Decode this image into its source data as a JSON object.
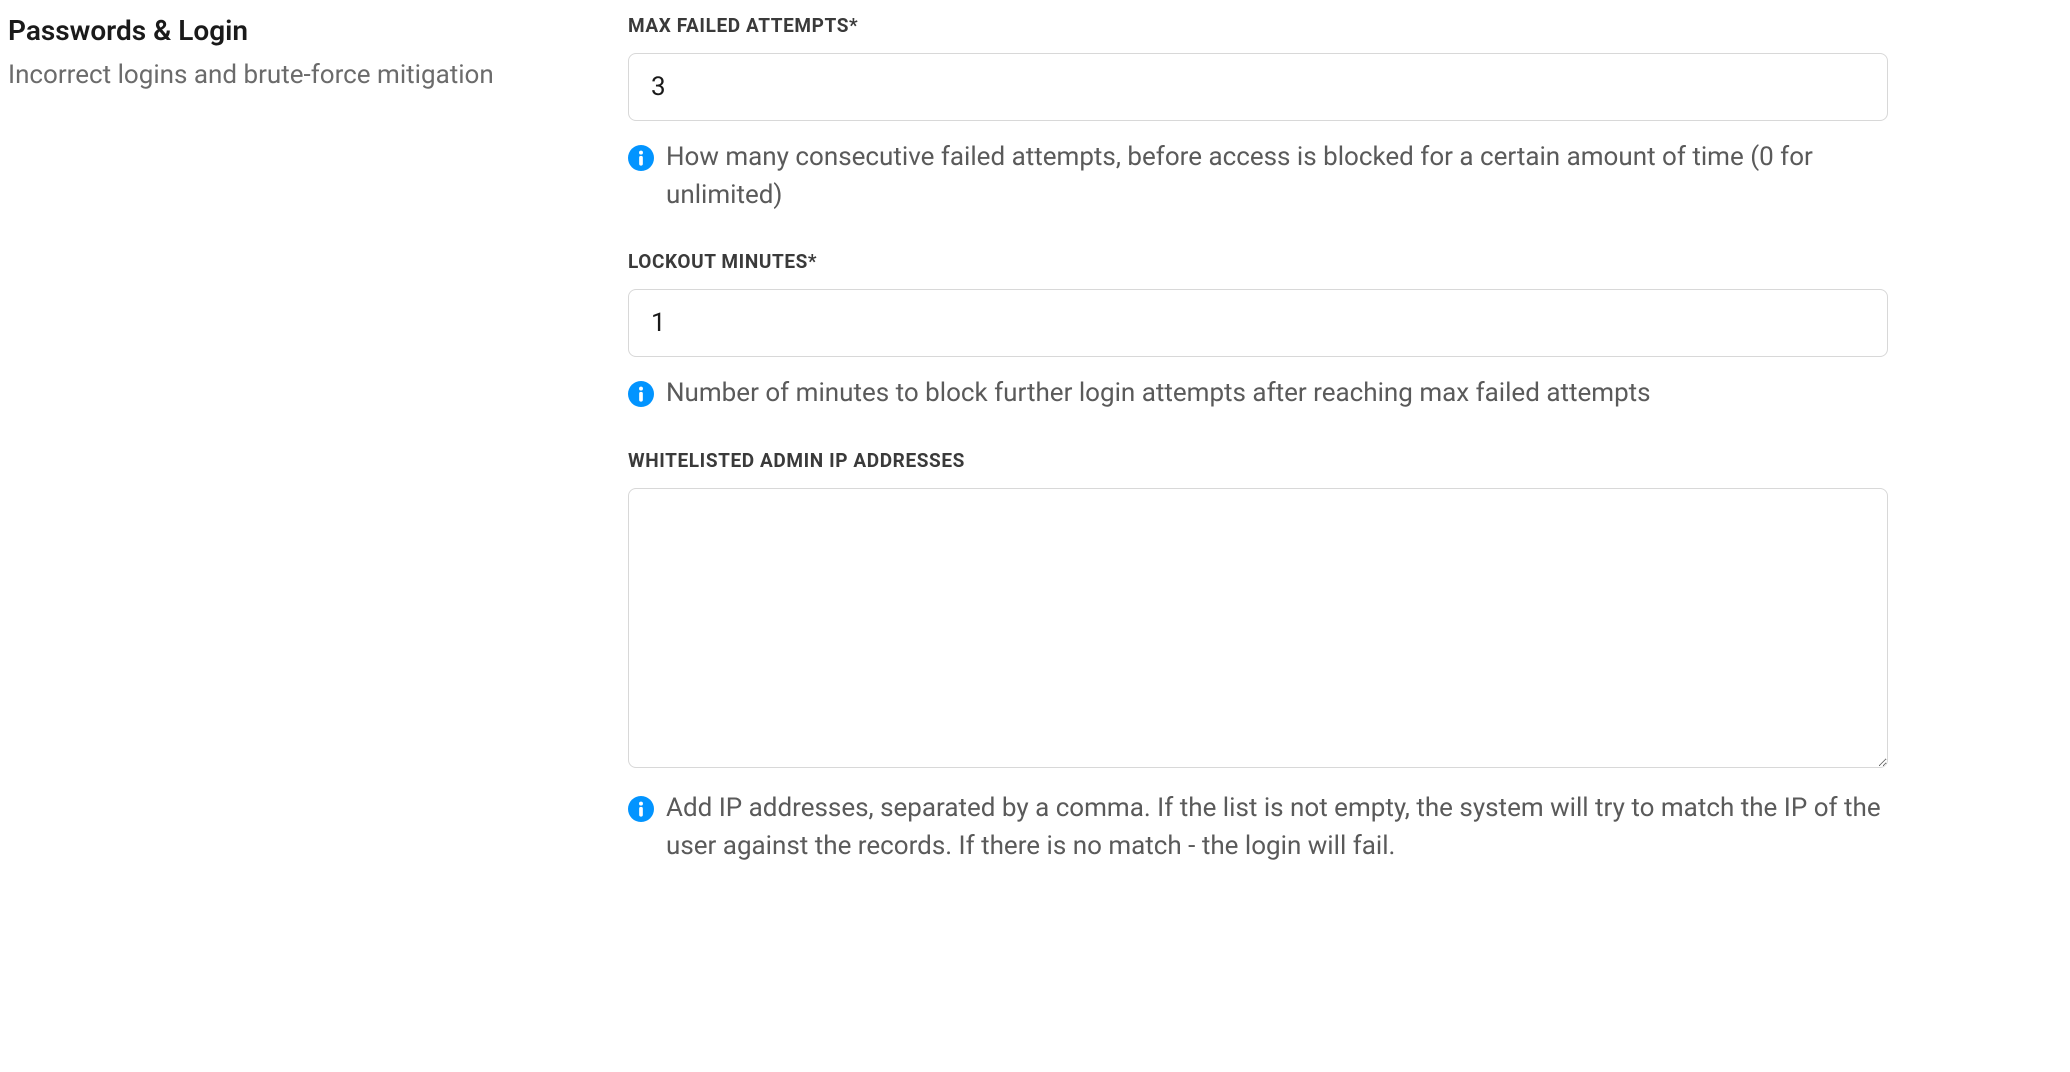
{
  "section": {
    "title": "Passwords & Login",
    "subtitle": "Incorrect logins and brute-force mitigation"
  },
  "fields": {
    "max_failed": {
      "label": "MAX FAILED ATTEMPTS*",
      "value": "3",
      "help": "How many consecutive failed attempts, before access is blocked for a certain amount of time (0 for unlimited)"
    },
    "lockout": {
      "label": "LOCKOUT MINUTES*",
      "value": "1",
      "help": "Number of minutes to block further login attempts after reaching max failed attempts"
    },
    "whitelist": {
      "label": "WHITELISTED ADMIN IP ADDRESSES",
      "value": "",
      "help": "Add IP addresses, separated by a comma. If the list is not empty, the system will try to match the IP of the user against the records. If there is no match - the login will fail."
    }
  },
  "colors": {
    "info_icon": "#0294ff"
  }
}
